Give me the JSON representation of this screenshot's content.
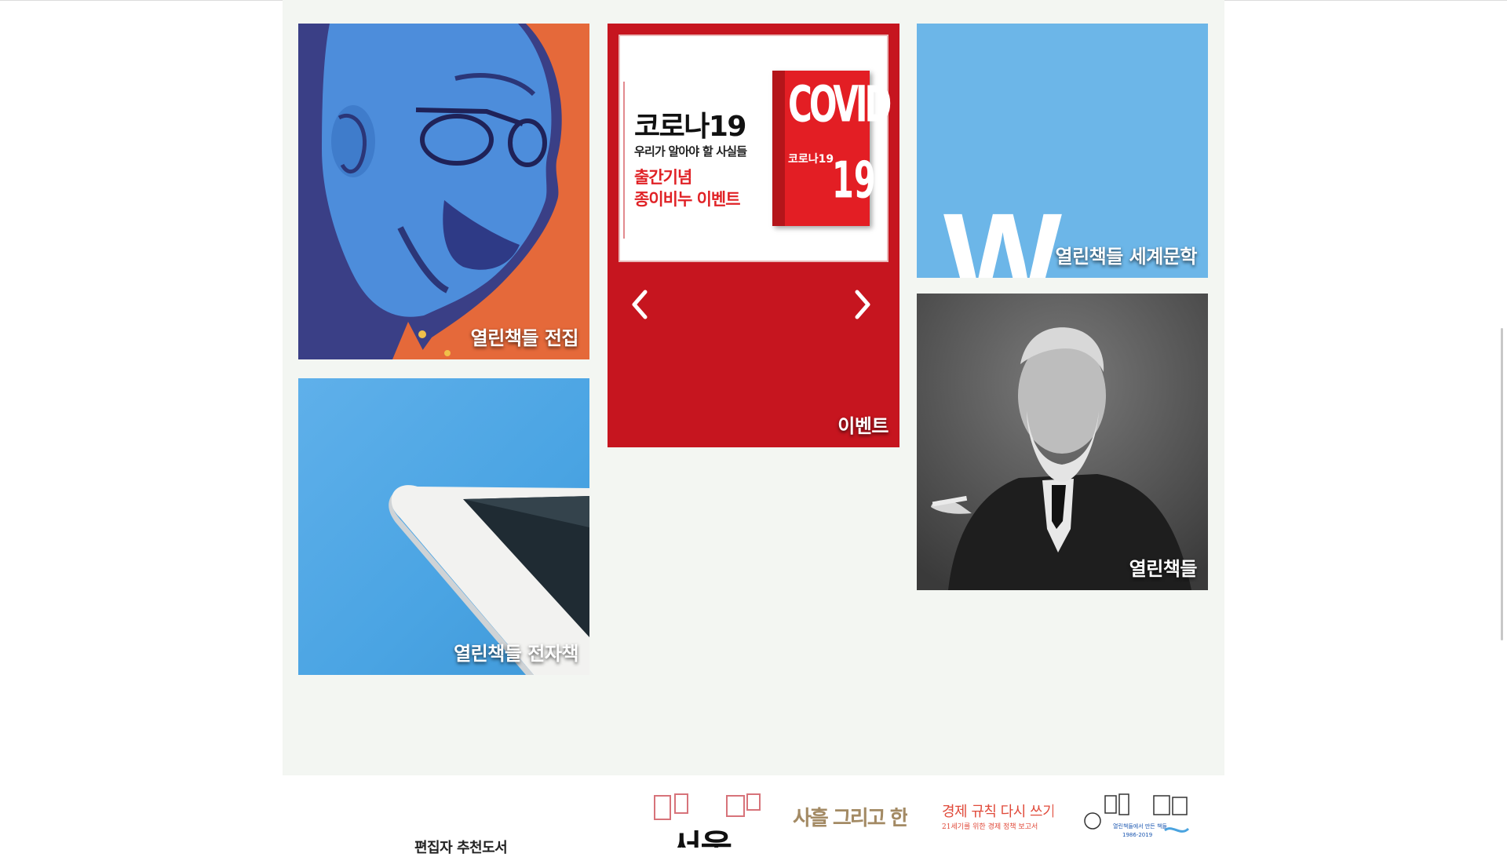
{
  "tiles": {
    "collected_works": {
      "label": "열린책들 전집"
    },
    "event": {
      "label": "이벤트",
      "banner": {
        "title": "코로나19",
        "subtitle": "우리가 알아야 할 사실들",
        "event_line1": "출간기념",
        "event_line2": "종이비누 이벤트"
      },
      "book": {
        "cover_title": "COVID",
        "cover_number": "19",
        "cover_sub": "코로나19"
      },
      "prev_icon": "chevron-left-icon",
      "next_icon": "chevron-right-icon"
    },
    "world_literature": {
      "logo_letter": "W",
      "label": "열린책들 세계문학"
    },
    "ebook": {
      "label": "열린책들 전자책"
    },
    "open_books": {
      "label": "열린책들"
    }
  },
  "recommended": {
    "heading": "편집자 추천도서",
    "books": [
      {
        "title": "서울"
      },
      {
        "title": "사흘 그리고 한 인생"
      },
      {
        "title": "경제 규칙 다시 쓰기",
        "subtitle": "21세기를 위한 경제 정책 보고서"
      },
      {
        "title": "열린책들에서 만든 책들",
        "subtitle": "1986-2019"
      }
    ]
  },
  "colors": {
    "panel_bg": "#f3f6f2",
    "event_red": "#c6151f",
    "world_blue": "#6cb6e8",
    "collected_orange": "#e5693a"
  }
}
